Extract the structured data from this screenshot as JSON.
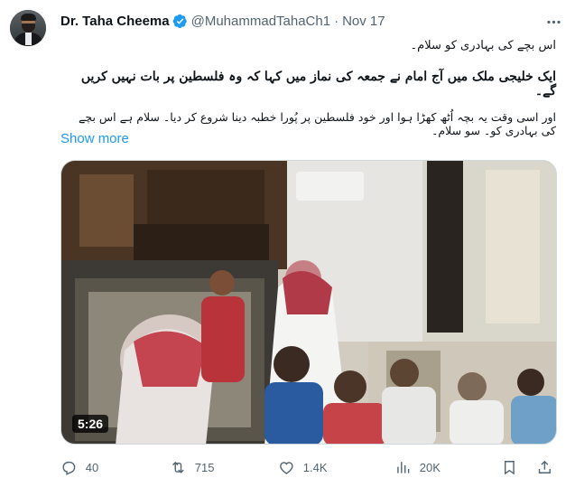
{
  "tweet": {
    "author_name": "Dr. Taha Cheema",
    "handle": "@MuhammadTahaCh1",
    "separator": "·",
    "date": "Nov 17",
    "text_lines": [
      "اس بچے کی بہادری کو سلام۔",
      "ایک خلیجی ملک میں آج امام نے جمعہ کی نماز میں کہا کہ وہ فلسطین پر بات نہیں کریں گے۔",
      "اور اسی وقت یہ بچہ اُٹھ کھڑا ہوا اور خود فلسطین پر پُورا خطبہ دینا شروع کر دیا۔ سلام ہے اس بچے کی بہادری کو۔ سو سلام۔"
    ],
    "show_more_label": "Show more",
    "video_duration": "5:26"
  },
  "actions": {
    "replies": "40",
    "retweets": "715",
    "likes": "1.4K",
    "views": "20K"
  },
  "colors": {
    "accent": "#1d9bf0",
    "secondary_text": "#536471",
    "primary_text": "#0f1419"
  },
  "icons": {
    "verified": "verified-badge-icon",
    "more": "more-dots-icon",
    "reply": "reply-icon",
    "retweet": "retweet-icon",
    "like": "heart-icon",
    "views": "views-chart-icon",
    "bookmark": "bookmark-icon",
    "share": "share-icon"
  }
}
